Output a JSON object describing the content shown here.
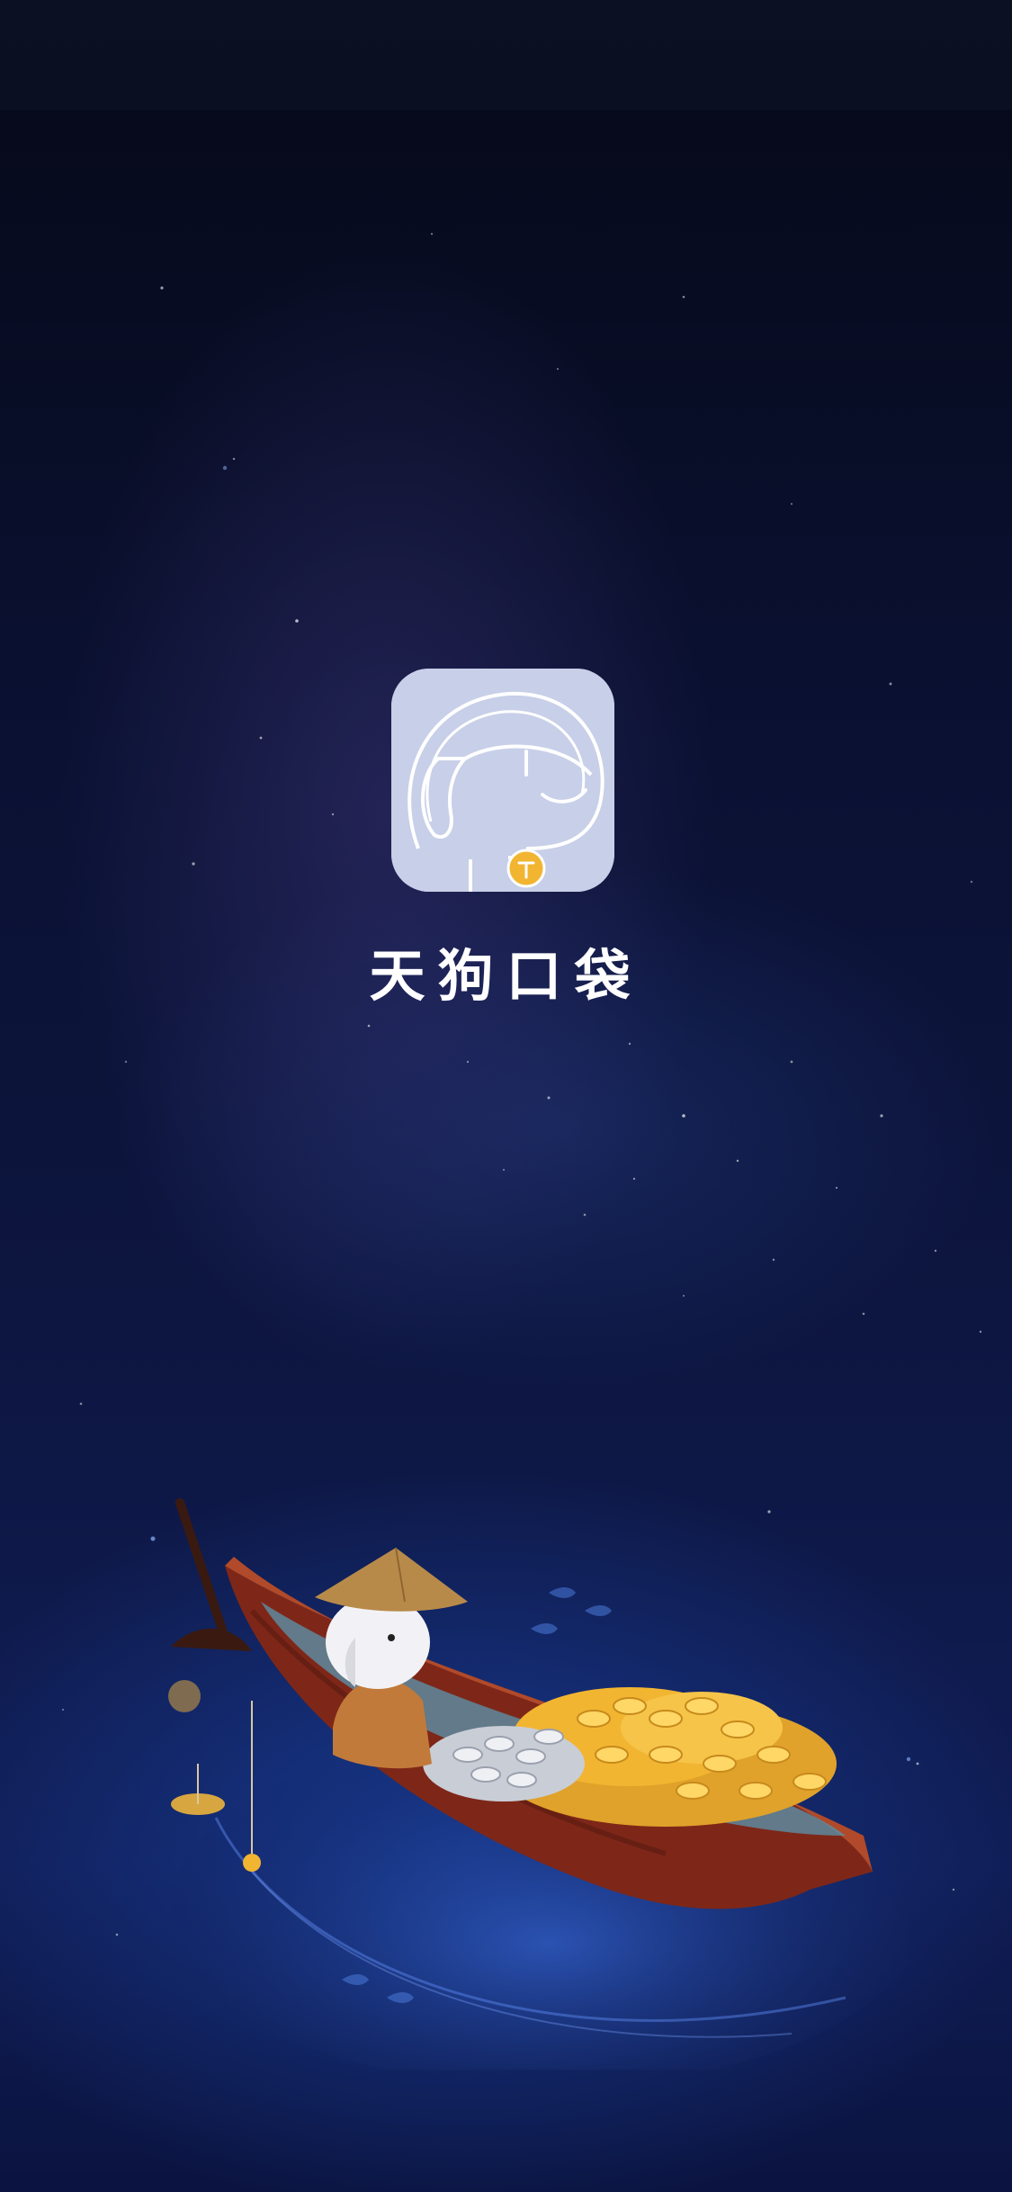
{
  "app": {
    "name": "天狗口袋",
    "icon": "astronaut-dog-icon"
  },
  "illustration": {
    "subject": "dog-fishing-on-boat-with-coins"
  },
  "colors": {
    "background_top": "#060917",
    "background_bottom": "#101d55",
    "icon_tile": "#c8cfe8",
    "coin_gold": "#f2b531",
    "boat_red": "#8e2b1e",
    "text": "#ffffff"
  }
}
